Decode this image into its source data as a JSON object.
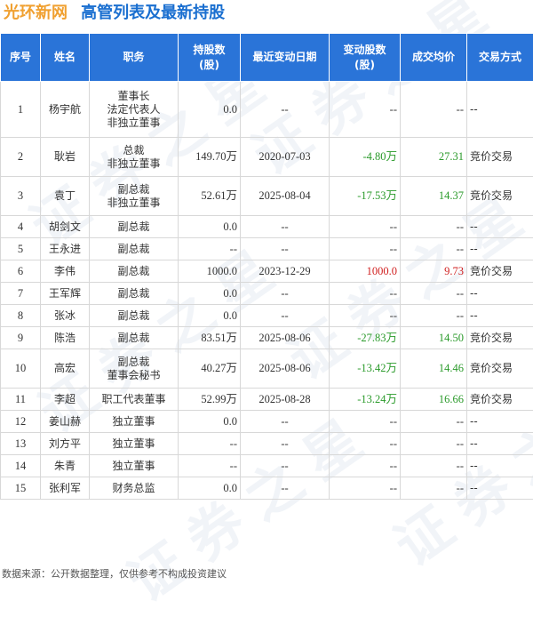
{
  "header": {
    "company": "光环新网",
    "title": "高管列表及最新持股"
  },
  "columns": [
    "序号",
    "姓名",
    "职务",
    "持股数\n(股)",
    "最近变动日期",
    "变动股数\n(股)",
    "成交均价",
    "交易方式"
  ],
  "rows": [
    {
      "no": "1",
      "name": "杨宇航",
      "role": "董事长\n法定代表人\n非独立董事",
      "shares": "0.0",
      "date": "--",
      "change": "--",
      "price": "--",
      "method": "--",
      "dir": "none"
    },
    {
      "no": "2",
      "name": "耿岩",
      "role": "总裁\n非独立董事",
      "shares": "149.70万",
      "date": "2020-07-03",
      "change": "-4.80万",
      "price": "27.31",
      "method": "竞价交易",
      "dir": "neg"
    },
    {
      "no": "3",
      "name": "袁丁",
      "role": "副总裁\n非独立董事",
      "shares": "52.61万",
      "date": "2025-08-04",
      "change": "-17.53万",
      "price": "14.37",
      "method": "竞价交易",
      "dir": "neg"
    },
    {
      "no": "4",
      "name": "胡剑文",
      "role": "副总裁",
      "shares": "0.0",
      "date": "--",
      "change": "--",
      "price": "--",
      "method": "--",
      "dir": "none"
    },
    {
      "no": "5",
      "name": "王永进",
      "role": "副总裁",
      "shares": "--",
      "date": "--",
      "change": "--",
      "price": "--",
      "method": "--",
      "dir": "none"
    },
    {
      "no": "6",
      "name": "李伟",
      "role": "副总裁",
      "shares": "1000.0",
      "date": "2023-12-29",
      "change": "1000.0",
      "price": "9.73",
      "method": "竞价交易",
      "dir": "pos"
    },
    {
      "no": "7",
      "name": "王军辉",
      "role": "副总裁",
      "shares": "0.0",
      "date": "--",
      "change": "--",
      "price": "--",
      "method": "--",
      "dir": "none"
    },
    {
      "no": "8",
      "name": "张冰",
      "role": "副总裁",
      "shares": "0.0",
      "date": "--",
      "change": "--",
      "price": "--",
      "method": "--",
      "dir": "none"
    },
    {
      "no": "9",
      "name": "陈浩",
      "role": "副总裁",
      "shares": "83.51万",
      "date": "2025-08-06",
      "change": "-27.83万",
      "price": "14.50",
      "method": "竞价交易",
      "dir": "neg"
    },
    {
      "no": "10",
      "name": "高宏",
      "role": "副总裁\n董事会秘书",
      "shares": "40.27万",
      "date": "2025-08-06",
      "change": "-13.42万",
      "price": "14.46",
      "method": "竞价交易",
      "dir": "neg"
    },
    {
      "no": "11",
      "name": "李超",
      "role": "职工代表董事",
      "shares": "52.99万",
      "date": "2025-08-28",
      "change": "-13.24万",
      "price": "16.66",
      "method": "竞价交易",
      "dir": "neg"
    },
    {
      "no": "12",
      "name": "姜山赫",
      "role": "独立董事",
      "shares": "0.0",
      "date": "--",
      "change": "--",
      "price": "--",
      "method": "--",
      "dir": "none"
    },
    {
      "no": "13",
      "name": "刘方平",
      "role": "独立董事",
      "shares": "--",
      "date": "--",
      "change": "--",
      "price": "--",
      "method": "--",
      "dir": "none"
    },
    {
      "no": "14",
      "name": "朱青",
      "role": "独立董事",
      "shares": "--",
      "date": "--",
      "change": "--",
      "price": "--",
      "method": "--",
      "dir": "none"
    },
    {
      "no": "15",
      "name": "张利军",
      "role": "财务总监",
      "shares": "0.0",
      "date": "--",
      "change": "--",
      "price": "--",
      "method": "--",
      "dir": "none"
    }
  ],
  "colors": {
    "header_bg": "#2a74d8",
    "company": "#f0a030",
    "title": "#1a6fd0",
    "negative": "#2a9a2a",
    "positive": "#d02020"
  },
  "footer": "数据来源：公开数据整理，仅供参考不构成投资建议",
  "watermark": "证券之星"
}
